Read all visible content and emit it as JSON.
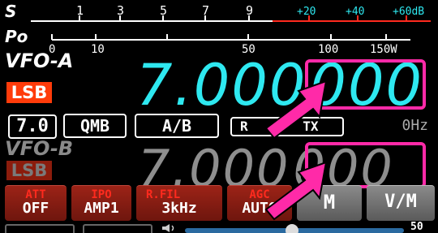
{
  "s_meter": {
    "label": "S",
    "scale": [
      "1",
      "3",
      "5",
      "7",
      "9"
    ],
    "scale_plus": [
      "+20",
      "+40",
      "+60dB"
    ]
  },
  "po_meter": {
    "label": "Po",
    "scale": [
      "0",
      "10",
      "50",
      "100",
      "150W"
    ]
  },
  "vfo_a": {
    "label": "VFO-A",
    "mode": "LSB",
    "freq_main": "7.000",
    "freq_sub": "000"
  },
  "controls_row": {
    "step": "7.0",
    "qmb": "QMB",
    "ab": "A/B",
    "rx": "R",
    "tx": "TX",
    "clar": "0Hz"
  },
  "vfo_b": {
    "label": "VFO-B",
    "mode": "LSB",
    "freq_main": "7.000",
    "freq_sub": "000"
  },
  "function_keys": [
    {
      "title": "ATT",
      "value": "OFF"
    },
    {
      "title": "IPO",
      "value": "AMP1"
    },
    {
      "title": "R.FIL",
      "value": "3kHz"
    },
    {
      "title": "AGC",
      "value": "AUTO"
    }
  ],
  "memory_keys": {
    "m": "M",
    "vm": "V/M"
  },
  "bottom": {
    "level_value": "50"
  },
  "colors": {
    "vfo_a_freq": "#2ee8f0",
    "vfo_b_freq": "#8e8e8e",
    "mode_badge": "#ff3b0a",
    "highlight": "#ff2aa8",
    "function_key_bg": "#9c2317",
    "function_key_title": "#ff2a1e"
  },
  "icons": {
    "speaker": "speaker-icon",
    "pointer": "pointer-arrow-icon"
  }
}
